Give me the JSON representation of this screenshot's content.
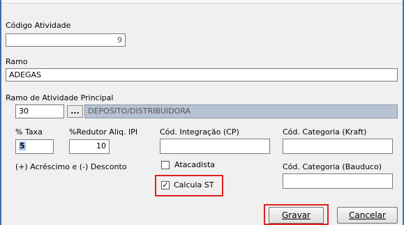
{
  "fields": {
    "codigo_atividade": {
      "label": "Código Atividade",
      "value": "9"
    },
    "ramo": {
      "label": "Ramo",
      "value": "ADEGAS"
    },
    "ramo_principal": {
      "label": "Ramo de Atividade Principal",
      "code": "30",
      "lookup_button": "...",
      "description": "DEPOSITO/DISTRIBUIDORA"
    },
    "taxa": {
      "label": "% Taxa",
      "value": "5"
    },
    "redutor": {
      "label": "%Redutor Aliq. IPI",
      "value": "10"
    },
    "cod_integracao": {
      "label": "Cód. Integração (CP)",
      "value": ""
    },
    "cod_categoria_kraft": {
      "label": "Cód. Categoria (Kraft)",
      "value": ""
    },
    "cod_categoria_bauduco": {
      "label": "Cód. Categoria (Bauduco)",
      "value": ""
    }
  },
  "hint": "(+) Acréscimo e (-) Desconto",
  "checkboxes": {
    "atacadista": {
      "label": "Atacadista",
      "checked": false,
      "mark": ""
    },
    "calcula_st": {
      "label": "Calcula ST",
      "checked": true,
      "mark": "✓"
    }
  },
  "buttons": {
    "gravar": {
      "label": "Gravar"
    },
    "cancelar": {
      "label": "Cancelar"
    }
  },
  "colors": {
    "highlight": "#e02020",
    "readonly": "#b7c3d3",
    "selection": "#aac8f0"
  }
}
